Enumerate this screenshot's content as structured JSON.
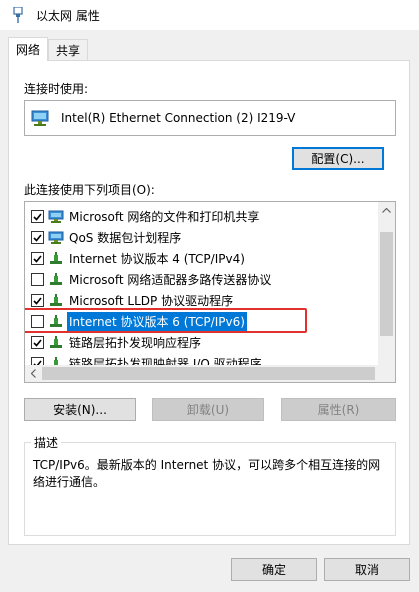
{
  "window": {
    "title": "以太网 属性"
  },
  "tabs": [
    {
      "label": "网络",
      "active": true
    },
    {
      "label": "共享",
      "active": false
    }
  ],
  "connect_using": {
    "label": "连接时使用:",
    "adapter_name": "Intel(R) Ethernet Connection (2) I219-V",
    "configure_button": "配置(C)..."
  },
  "items_section": {
    "label": "此连接使用下列项目(O):",
    "items": [
      {
        "label": "Microsoft 网络的文件和打印机共享",
        "checked": true,
        "icon": "network-share-icon",
        "selected": false
      },
      {
        "label": "QoS 数据包计划程序",
        "checked": true,
        "icon": "network-share-icon",
        "selected": false
      },
      {
        "label": "Internet 协议版本 4 (TCP/IPv4)",
        "checked": true,
        "icon": "protocol-icon",
        "selected": false
      },
      {
        "label": "Microsoft 网络适配器多路传送器协议",
        "checked": false,
        "icon": "protocol-icon",
        "selected": false
      },
      {
        "label": "Microsoft LLDP 协议驱动程序",
        "checked": true,
        "icon": "protocol-icon",
        "selected": false
      },
      {
        "label": "Internet 协议版本 6 (TCP/IPv6)",
        "checked": false,
        "icon": "protocol-icon",
        "selected": true
      },
      {
        "label": "链路层拓扑发现响应程序",
        "checked": true,
        "icon": "protocol-icon",
        "selected": false
      },
      {
        "label": "链路层拓扑发现映射器 I/O 驱动程序",
        "checked": true,
        "icon": "protocol-icon",
        "selected": false
      }
    ]
  },
  "item_buttons": {
    "install": "安装(N)...",
    "uninstall": "卸载(U)",
    "properties": "属性(R)"
  },
  "description": {
    "legend": "描述",
    "text": "TCP/IPv6。最新版本的 Internet 协议，可以跨多个相互连接的网络进行通信。"
  },
  "dialog_buttons": {
    "ok": "确定",
    "cancel": "取消"
  },
  "colors": {
    "selection": "#0078d7",
    "highlight_box": "#e0312d",
    "focus_border": "#0078d7"
  }
}
